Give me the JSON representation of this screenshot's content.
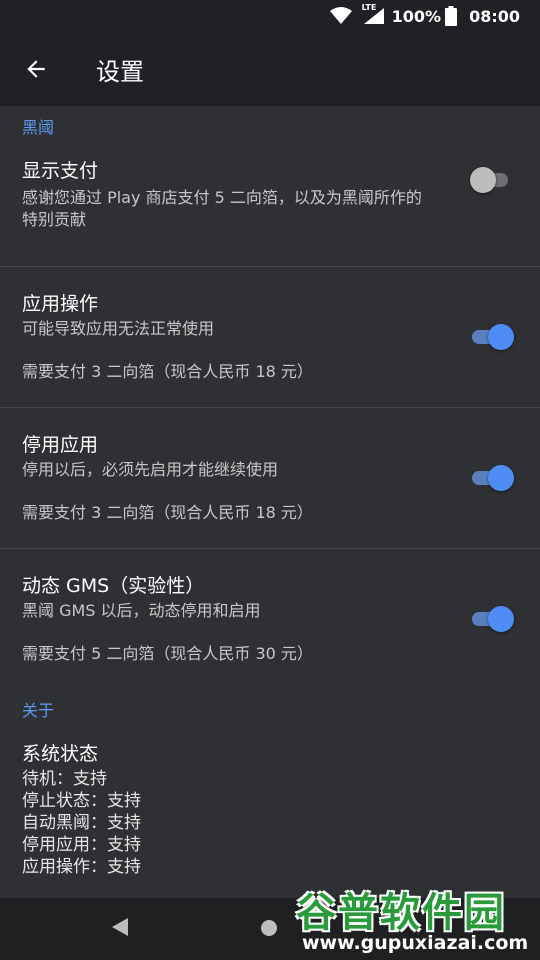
{
  "status_bar": {
    "network": "LTE",
    "battery": "100%",
    "time": "08:00"
  },
  "app_bar": {
    "title": "设置"
  },
  "sections": {
    "heiyu": {
      "header": "黑阈",
      "show_pay": {
        "title": "显示支付",
        "summary": "感谢您通过 Play 商店支付 5 二向箔，以及为黑阈所作的特别贡献",
        "enabled": false
      },
      "app_ops": {
        "title": "应用操作",
        "summary": "可能导致应用无法正常使用",
        "extra": "需要支付 3 二向箔（现合人民币 18 元）",
        "enabled": true
      },
      "disable_app": {
        "title": "停用应用",
        "summary": "停用以后，必须先启用才能继续使用",
        "extra": "需要支付 3 二向箔（现合人民币 18 元）",
        "enabled": true
      },
      "dynamic_gms": {
        "title": "动态 GMS（实验性）",
        "summary": "黑阈 GMS 以后，动态停用和启用",
        "extra": "需要支付 5 二向箔（现合人民币 30 元）",
        "enabled": true
      }
    },
    "about": {
      "header": "关于",
      "system_status": {
        "title": "系统状态",
        "lines": [
          "待机：支持",
          "停止状态：支持",
          "自动黑阈：支持",
          "停用应用：支持",
          "应用操作：支持"
        ]
      }
    }
  },
  "watermark": {
    "name": "谷普软件园",
    "url": "www.gupuxiazai.com"
  },
  "colors": {
    "accent": "#5b9bf6",
    "toggle_on": "#4d8df5",
    "background": "#2f3033",
    "bar": "#202124",
    "watermark_green": "#2a9b3a"
  }
}
